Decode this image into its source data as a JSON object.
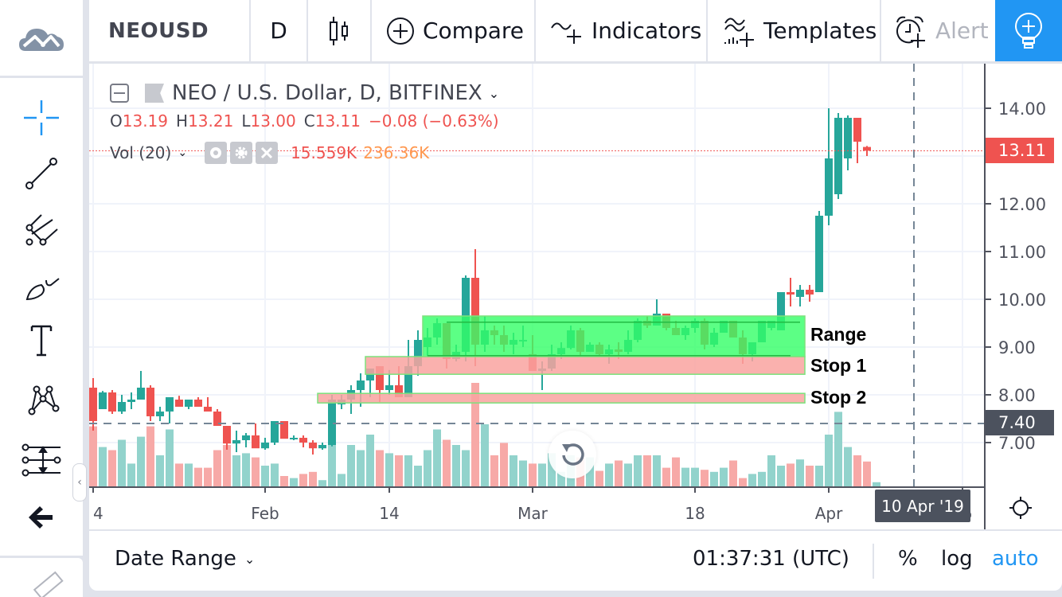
{
  "toolbar": {
    "symbol": "NEOUSD",
    "interval": "D",
    "compare_label": "Compare",
    "indicators_label": "Indicators",
    "templates_label": "Templates",
    "alert_label": "Alert"
  },
  "left_tools": [
    {
      "name": "crosshair-icon",
      "active": true
    },
    {
      "name": "trend-line-icon"
    },
    {
      "name": "pitchfork-icon"
    },
    {
      "name": "brush-icon"
    },
    {
      "name": "text-icon"
    },
    {
      "name": "pattern-icon"
    },
    {
      "name": "prediction-measure-icon"
    },
    {
      "name": "back-arrow-icon"
    }
  ],
  "legend": {
    "title": "NEO / U.S. Dollar, D, BITFINEX",
    "ohlc": {
      "o_label": "O",
      "o": "13.19",
      "h_label": "H",
      "h": "13.21",
      "l_label": "L",
      "l": "13.00",
      "c_label": "C",
      "c": "13.11",
      "change": "−0.08 (−0.63%)"
    },
    "volume": {
      "label": "Vol (20)",
      "value": "15.559K",
      "ma_value": "236.36K"
    }
  },
  "annotations": {
    "range": "Range",
    "stop1": "Stop 1",
    "stop2": "Stop 2"
  },
  "price_labels": {
    "last": "13.11",
    "crosshair": "7.40"
  },
  "crosshair_date": "10 Apr '19",
  "bottom_bar": {
    "date_range_label": "Date Range",
    "clock": "01:37:31 (UTC)",
    "percent_label": "%",
    "log_label": "log",
    "auto_label": "auto"
  },
  "colors": {
    "up": "#26a69a",
    "down": "#ef5350",
    "up_vol": "#92d3cc",
    "down_vol": "#f7a9a7",
    "range_box": "#33ff66",
    "stop_box": "#f9a3a0",
    "accent": "#2196f3"
  },
  "chart_data": {
    "type": "candlestick",
    "symbol": "NEO / U.S. Dollar",
    "interval": "D",
    "exchange": "BITFINEX",
    "y_ticks": [
      "14.00",
      "13.00",
      "12.00",
      "11.00",
      "10.00",
      "9.00",
      "8.00",
      "7.00"
    ],
    "y_tick_values": [
      14,
      13,
      12,
      11,
      10,
      9,
      8,
      7
    ],
    "ylim": [
      6.1,
      14.8
    ],
    "x_ticks": [
      "4",
      "Feb",
      "14",
      "Mar",
      "18",
      "Apr",
      "15"
    ],
    "x_tick_day_index": [
      0,
      18,
      31,
      46,
      63,
      77,
      91
    ],
    "first_day_label": "4",
    "candles": [
      [
        8.15,
        8.35,
        7.25,
        7.45
      ],
      [
        7.7,
        8.08,
        7.7,
        8.05
      ],
      [
        8.05,
        8.1,
        7.6,
        7.65
      ],
      [
        7.65,
        8.0,
        7.6,
        7.85
      ],
      [
        7.85,
        8.05,
        7.7,
        7.9
      ],
      [
        7.9,
        8.5,
        7.9,
        8.15
      ],
      [
        8.15,
        8.2,
        7.45,
        7.55
      ],
      [
        7.55,
        7.75,
        7.45,
        7.65
      ],
      [
        7.65,
        7.95,
        7.4,
        7.95
      ],
      [
        7.9,
        7.98,
        7.75,
        7.75
      ],
      [
        7.75,
        7.9,
        7.7,
        7.9
      ],
      [
        7.9,
        7.95,
        7.75,
        7.75
      ],
      [
        7.75,
        7.95,
        7.65,
        7.65
      ],
      [
        7.65,
        7.7,
        7.35,
        7.35
      ],
      [
        7.35,
        7.35,
        6.85,
        6.98
      ],
      [
        6.98,
        7.25,
        6.8,
        7.05
      ],
      [
        7.05,
        7.2,
        6.9,
        7.15
      ],
      [
        7.15,
        7.4,
        6.9,
        6.88
      ],
      [
        6.88,
        7.1,
        6.85,
        7.0
      ],
      [
        7.0,
        7.45,
        6.95,
        7.45
      ],
      [
        7.45,
        7.45,
        7.15,
        7.08
      ],
      [
        7.08,
        7.15,
        7.05,
        7.1
      ],
      [
        7.1,
        7.15,
        6.9,
        7.0
      ],
      [
        7.0,
        7.05,
        6.75,
        6.88
      ],
      [
        6.88,
        7.0,
        6.85,
        6.95
      ],
      [
        6.95,
        8.0,
        6.92,
        7.9
      ],
      [
        7.8,
        8.0,
        7.7,
        7.9
      ],
      [
        7.9,
        8.2,
        7.6,
        8.1
      ],
      [
        8.1,
        8.45,
        7.75,
        8.3
      ],
      [
        8.3,
        8.5,
        7.95,
        8.55
      ],
      [
        8.6,
        8.6,
        7.85,
        8.1
      ],
      [
        8.1,
        8.52,
        8.0,
        8.2
      ],
      [
        8.2,
        8.6,
        7.95,
        7.95
      ],
      [
        7.95,
        9.15,
        7.95,
        8.6
      ],
      [
        8.6,
        9.35,
        8.4,
        9.15
      ],
      [
        9.0,
        9.4,
        8.8,
        9.2
      ],
      [
        9.2,
        9.6,
        9.05,
        9.5
      ],
      [
        9.5,
        9.45,
        8.55,
        8.75
      ],
      [
        8.75,
        9.05,
        8.7,
        8.9
      ],
      [
        8.9,
        10.5,
        8.7,
        10.45
      ],
      [
        10.45,
        11.05,
        8.6,
        9.05
      ],
      [
        9.05,
        9.65,
        8.9,
        9.35
      ],
      [
        9.35,
        9.45,
        9.05,
        9.25
      ],
      [
        9.25,
        9.45,
        8.9,
        9.05
      ],
      [
        9.05,
        9.3,
        8.85,
        9.15
      ],
      [
        9.15,
        9.45,
        9.0,
        9.15
      ],
      [
        8.85,
        9.25,
        8.85,
        8.5
      ],
      [
        8.5,
        8.7,
        8.1,
        8.55
      ],
      [
        8.55,
        9.05,
        8.5,
        8.85
      ],
      [
        8.85,
        9.1,
        8.75,
        8.98
      ],
      [
        8.98,
        9.45,
        8.95,
        9.35
      ],
      [
        9.35,
        9.4,
        8.8,
        8.9
      ],
      [
        8.9,
        9.1,
        8.9,
        9.05
      ],
      [
        9.05,
        9.1,
        8.8,
        8.85
      ],
      [
        8.85,
        9.05,
        8.65,
        8.95
      ],
      [
        8.95,
        9.1,
        8.75,
        8.9
      ],
      [
        8.9,
        9.35,
        8.85,
        9.15
      ],
      [
        9.15,
        9.6,
        9.1,
        9.55
      ],
      [
        9.55,
        9.65,
        9.4,
        9.45
      ],
      [
        9.45,
        10.0,
        9.45,
        9.7
      ],
      [
        9.7,
        9.7,
        9.35,
        9.4
      ],
      [
        9.4,
        9.55,
        9.25,
        9.25
      ],
      [
        9.25,
        9.45,
        9.15,
        9.4
      ],
      [
        9.4,
        9.6,
        9.3,
        9.55
      ],
      [
        9.55,
        9.6,
        8.95,
        9.05
      ],
      [
        9.05,
        9.4,
        9.0,
        9.3
      ],
      [
        9.3,
        9.55,
        9.3,
        9.55
      ],
      [
        9.55,
        9.55,
        9.2,
        9.2
      ],
      [
        9.2,
        9.35,
        8.65,
        8.85
      ],
      [
        8.85,
        9.05,
        8.7,
        9.1
      ],
      [
        9.1,
        9.55,
        9.1,
        9.55
      ],
      [
        9.4,
        9.55,
        9.35,
        9.55
      ],
      [
        9.35,
        10.15,
        9.35,
        10.15
      ],
      [
        10.15,
        10.45,
        9.85,
        10.1
      ],
      [
        10.05,
        10.3,
        9.85,
        10.2
      ],
      [
        10.2,
        10.3,
        9.95,
        10.1
      ],
      [
        10.15,
        11.85,
        10.15,
        11.75
      ],
      [
        11.75,
        14.0,
        11.55,
        12.95
      ],
      [
        12.2,
        13.9,
        12.1,
        13.8
      ],
      [
        12.95,
        13.85,
        12.7,
        13.8
      ],
      [
        13.8,
        13.75,
        12.85,
        13.3
      ],
      [
        13.19,
        13.21,
        13.0,
        13.11
      ]
    ],
    "volume_relative": [
      0.58,
      0.38,
      0.35,
      0.45,
      0.22,
      0.48,
      0.58,
      0.3,
      0.55,
      0.22,
      0.22,
      0.18,
      0.18,
      0.35,
      0.4,
      0.3,
      0.32,
      0.28,
      0.2,
      0.22,
      0.1,
      0.08,
      0.12,
      0.14,
      0.06,
      0.5,
      0.12,
      0.4,
      0.35,
      0.5,
      0.35,
      0.32,
      0.3,
      0.3,
      0.2,
      0.35,
      0.55,
      0.45,
      0.4,
      0.35,
      1.0,
      0.6,
      0.3,
      0.42,
      0.3,
      0.25,
      0.22,
      0.22,
      0.32,
      0.14,
      0.3,
      0.28,
      0.28,
      0.15,
      0.22,
      0.25,
      0.22,
      0.3,
      0.3,
      0.3,
      0.18,
      0.28,
      0.18,
      0.18,
      0.16,
      0.14,
      0.18,
      0.25,
      0.08,
      0.12,
      0.14,
      0.3,
      0.2,
      0.22,
      0.26,
      0.2,
      0.2,
      0.5,
      0.72,
      0.38,
      0.3,
      0.24,
      0.04
    ],
    "hlines": [
      {
        "label": "crosshair",
        "price": 7.4,
        "style": "dashed"
      },
      {
        "label": "last",
        "price": 13.11,
        "style": "dotted"
      }
    ],
    "crosshair_date": "10 Apr '19",
    "boxes": [
      {
        "label": "Range",
        "top": 9.65,
        "bottom": 8.8,
        "start_index": 35,
        "end_index": 74,
        "color": "#33ff66"
      },
      {
        "label": "Stop 1",
        "top": 8.8,
        "bottom": 8.43,
        "start_index": 29,
        "end_index": 74,
        "color": "#f9a3a0"
      },
      {
        "label": "Stop 2",
        "top": 8.03,
        "bottom": 7.83,
        "start_index": 24,
        "end_index": 74,
        "color": "#f9a3a0"
      }
    ]
  }
}
